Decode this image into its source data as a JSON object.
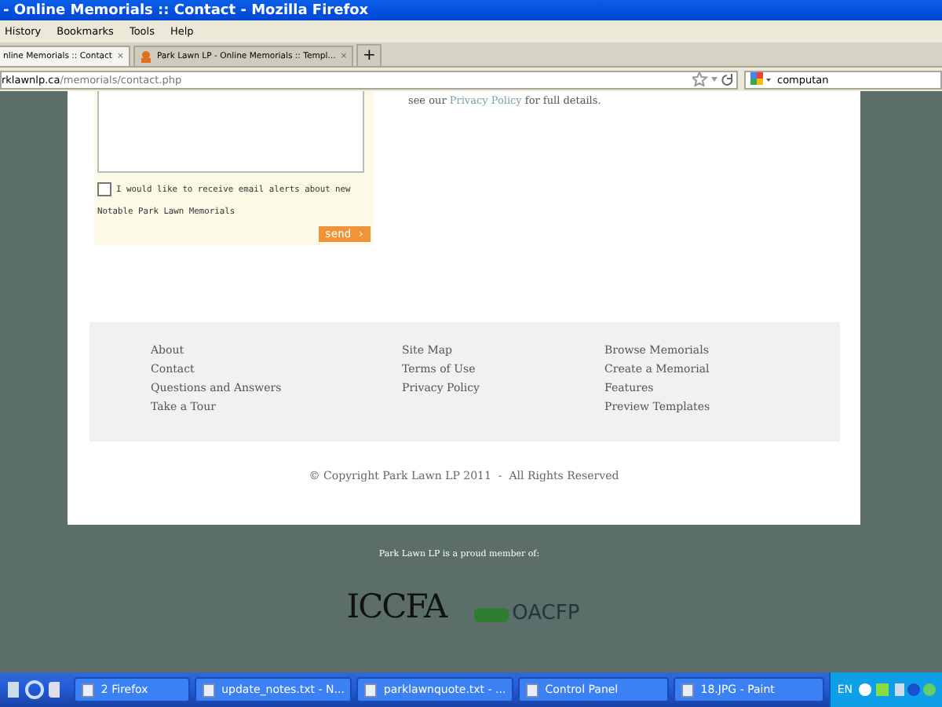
{
  "window": {
    "title": "- Online Memorials :: Contact - Mozilla Firefox"
  },
  "menu": [
    "History",
    "Bookmarks",
    "Tools",
    "Help"
  ],
  "tabs": [
    {
      "label": "nline Memorials :: Contact",
      "selected": true,
      "close": "×"
    },
    {
      "label": "Park Lawn LP - Online Memorials :: Templ...",
      "selected": false,
      "close": "×"
    }
  ],
  "new_tab": "+",
  "address": {
    "host": "rklawnlp.ca",
    "path": "/memorials/contact.php"
  },
  "search": {
    "value": "computan"
  },
  "form": {
    "alerts": {
      "label": "I would like to receive email alerts about new",
      "checked": false
    },
    "note": "Notable Park Lawn Memorials",
    "send": "send ›"
  },
  "privacy": {
    "before": "see our",
    "link": "Privacy Policy",
    "after": "for full details."
  },
  "footer_columns": [
    [
      "About",
      "Contact",
      "Questions and Answers",
      "Take a Tour"
    ],
    [
      "Site Map",
      "Terms of Use",
      "Privacy Policy"
    ],
    [
      "Browse Memorials",
      "Create a Memorial",
      "Features",
      "Preview Templates"
    ]
  ],
  "copyright": "© Copyright Park Lawn LP 2011  -  All Rights Reserved",
  "member_text": "Park Lawn LP is a proud member of:",
  "logos": [
    "ICCFA",
    "OACFP"
  ],
  "taskbar": {
    "items": [
      "2 Firefox",
      "update_notes.txt - N...",
      "parklawnquote.txt - ...",
      "Control Panel",
      "18.JPG - Paint"
    ],
    "language": "EN"
  }
}
